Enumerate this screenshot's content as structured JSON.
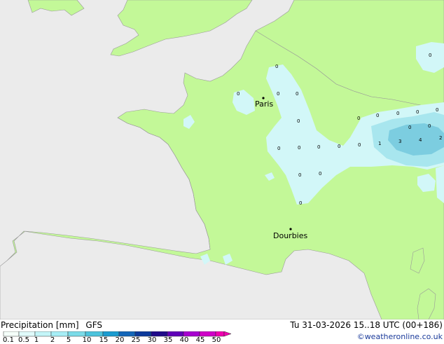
{
  "map": {
    "cities": [
      {
        "name": "Paris"
      },
      {
        "name": "Dourbies"
      }
    ],
    "cell_values": [
      "0",
      "0",
      "0",
      "0",
      "0",
      "0",
      "0",
      "0",
      "0",
      "0",
      "0",
      "0",
      "0",
      "0",
      "0",
      "0",
      "0",
      "0",
      "0",
      "0",
      "0",
      "1",
      "3",
      "4",
      "2"
    ]
  },
  "footer": {
    "title": "Precipitation [mm]",
    "model": "GFS",
    "datetime": "Tu 31-03-2026 15..18 UTC (00+186)",
    "credit": "©weatheronline.co.uk"
  },
  "legend": {
    "ticks": [
      "0.1",
      "0.5",
      "1",
      "2",
      "5",
      "10",
      "15",
      "20",
      "25",
      "30",
      "35",
      "40",
      "45",
      "50"
    ],
    "colors": [
      "#f5fffa",
      "#e0fbfb",
      "#c3f5f8",
      "#a7eef6",
      "#7bdbe8",
      "#4cc3dc",
      "#1a9cd0",
      "#1366b8",
      "#0c3a9c",
      "#200a8a",
      "#6000b8",
      "#a800d0",
      "#d000c8",
      "#f000b0"
    ]
  },
  "colors": {
    "sea": "#ebebeb",
    "land": "#c3f898",
    "precip_light": "#d2f7f8",
    "precip_mid": "#a8e6ee",
    "precip_high": "#7ccde0"
  }
}
